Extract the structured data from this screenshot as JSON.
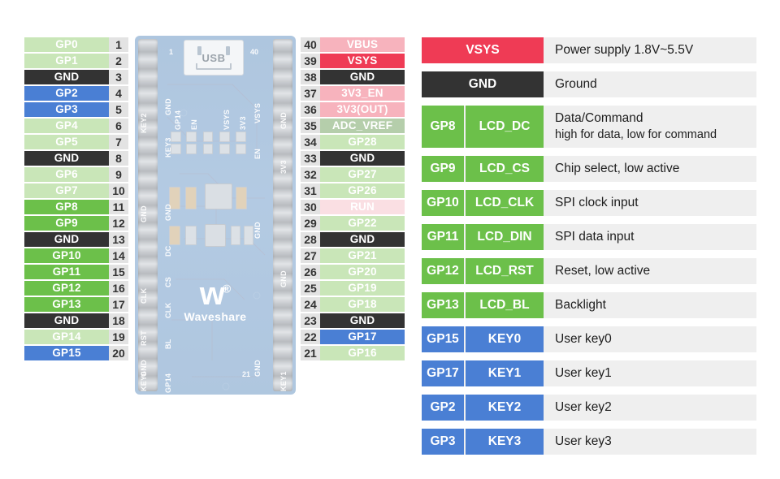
{
  "colors": {
    "gpio_light": "#c9e6b8",
    "gpio_bright": "#6cc04a",
    "ground": "#333333",
    "key_blue": "#4a7fd4",
    "vsys_red": "#ef3b55",
    "power_pink": "#f7b3bd",
    "run_pink": "#fadfe3",
    "adcref_green": "#b5ceab",
    "pin_number_bg": "#e3e3e3",
    "legend_row_bg": "#efefef"
  },
  "board": {
    "usb_label": "USB",
    "brand": "Waveshare",
    "brand_mark": "w",
    "registered": "®",
    "pin1_number": "1",
    "pin21_number": "21",
    "pin40_number": "40",
    "silkscreen_left_outer": [
      "KEY2",
      "GND",
      "KEY0"
    ],
    "silkscreen_left_inner": [
      "GND",
      "KEY3",
      "DC",
      "CS",
      "CLK",
      "RST",
      "BL",
      "GP14"
    ],
    "silkscreen_right_inner": [
      "VSYS",
      "EN",
      "GND",
      "GND"
    ],
    "silkscreen_right_outer": [
      "GND",
      "3V3",
      "GND",
      "KEY1"
    ],
    "test_pads": [
      "GP14",
      "EN",
      "VSYS",
      "3V3"
    ]
  },
  "left_pins": [
    {
      "number": "1",
      "label": "GP0",
      "style": "c-gp"
    },
    {
      "number": "2",
      "label": "GP1",
      "style": "c-gp"
    },
    {
      "number": "3",
      "label": "GND",
      "style": "c-gnd"
    },
    {
      "number": "4",
      "label": "GP2",
      "style": "c-key"
    },
    {
      "number": "5",
      "label": "GP3",
      "style": "c-key"
    },
    {
      "number": "6",
      "label": "GP4",
      "style": "c-gp"
    },
    {
      "number": "7",
      "label": "GP5",
      "style": "c-gp"
    },
    {
      "number": "8",
      "label": "GND",
      "style": "c-gnd"
    },
    {
      "number": "9",
      "label": "GP6",
      "style": "c-gp"
    },
    {
      "number": "10",
      "label": "GP7",
      "style": "c-gp"
    },
    {
      "number": "11",
      "label": "GP8",
      "style": "c-gp-bright"
    },
    {
      "number": "12",
      "label": "GP9",
      "style": "c-gp-bright"
    },
    {
      "number": "13",
      "label": "GND",
      "style": "c-gnd"
    },
    {
      "number": "14",
      "label": "GP10",
      "style": "c-gp-bright"
    },
    {
      "number": "15",
      "label": "GP11",
      "style": "c-gp-bright"
    },
    {
      "number": "16",
      "label": "GP12",
      "style": "c-gp-bright"
    },
    {
      "number": "17",
      "label": "GP13",
      "style": "c-gp-bright"
    },
    {
      "number": "18",
      "label": "GND",
      "style": "c-gnd"
    },
    {
      "number": "19",
      "label": "GP14",
      "style": "c-gp"
    },
    {
      "number": "20",
      "label": "GP15",
      "style": "c-key"
    }
  ],
  "right_pins": [
    {
      "number": "40",
      "label": "VBUS",
      "style": "c-power"
    },
    {
      "number": "39",
      "label": "VSYS",
      "style": "c-vsys"
    },
    {
      "number": "38",
      "label": "GND",
      "style": "c-gnd"
    },
    {
      "number": "37",
      "label": "3V3_EN",
      "style": "c-power"
    },
    {
      "number": "36",
      "label": "3V3(OUT)",
      "style": "c-power"
    },
    {
      "number": "35",
      "label": "ADC_VREF",
      "style": "c-adcref"
    },
    {
      "number": "34",
      "label": "GP28",
      "style": "c-gp"
    },
    {
      "number": "33",
      "label": "GND",
      "style": "c-gnd"
    },
    {
      "number": "32",
      "label": "GP27",
      "style": "c-gp"
    },
    {
      "number": "31",
      "label": "GP26",
      "style": "c-gp"
    },
    {
      "number": "30",
      "label": "RUN",
      "style": "c-run"
    },
    {
      "number": "29",
      "label": "GP22",
      "style": "c-gp"
    },
    {
      "number": "28",
      "label": "GND",
      "style": "c-gnd"
    },
    {
      "number": "27",
      "label": "GP21",
      "style": "c-gp"
    },
    {
      "number": "26",
      "label": "GP20",
      "style": "c-gp"
    },
    {
      "number": "25",
      "label": "GP19",
      "style": "c-gp"
    },
    {
      "number": "24",
      "label": "GP18",
      "style": "c-gp"
    },
    {
      "number": "23",
      "label": "GND",
      "style": "c-gnd"
    },
    {
      "number": "22",
      "label": "GP17",
      "style": "c-key"
    },
    {
      "number": "21",
      "label": "GP16",
      "style": "c-gp"
    }
  ],
  "legend": [
    {
      "gpio": "",
      "func": "VSYS",
      "style": "c-vsys",
      "single": true,
      "desc1": "Power supply 1.8V~5.5V",
      "desc2": ""
    },
    {
      "gpio": "",
      "func": "GND",
      "style": "c-gnd",
      "single": true,
      "desc1": "Ground",
      "desc2": ""
    },
    {
      "gpio": "GP8",
      "func": "LCD_DC",
      "style": "c-gp-bright",
      "single": false,
      "desc1": "Data/Command",
      "desc2": "high for data, low for command"
    },
    {
      "gpio": "GP9",
      "func": "LCD_CS",
      "style": "c-gp-bright",
      "single": false,
      "desc1": "Chip select, low active",
      "desc2": ""
    },
    {
      "gpio": "GP10",
      "func": "LCD_CLK",
      "style": "c-gp-bright",
      "single": false,
      "desc1": "SPI clock input",
      "desc2": ""
    },
    {
      "gpio": "GP11",
      "func": "LCD_DIN",
      "style": "c-gp-bright",
      "single": false,
      "desc1": "SPI data input",
      "desc2": ""
    },
    {
      "gpio": "GP12",
      "func": "LCD_RST",
      "style": "c-gp-bright",
      "single": false,
      "desc1": "Reset, low active",
      "desc2": ""
    },
    {
      "gpio": "GP13",
      "func": "LCD_BL",
      "style": "c-gp-bright",
      "single": false,
      "desc1": "Backlight",
      "desc2": ""
    },
    {
      "gpio": "GP15",
      "func": "KEY0",
      "style": "c-key",
      "single": false,
      "desc1": "User key0",
      "desc2": ""
    },
    {
      "gpio": "GP17",
      "func": "KEY1",
      "style": "c-key",
      "single": false,
      "desc1": "User key1",
      "desc2": ""
    },
    {
      "gpio": "GP2",
      "func": "KEY2",
      "style": "c-key",
      "single": false,
      "desc1": "User key2",
      "desc2": ""
    },
    {
      "gpio": "GP3",
      "func": "KEY3",
      "style": "c-key",
      "single": false,
      "desc1": "User key3",
      "desc2": ""
    }
  ]
}
